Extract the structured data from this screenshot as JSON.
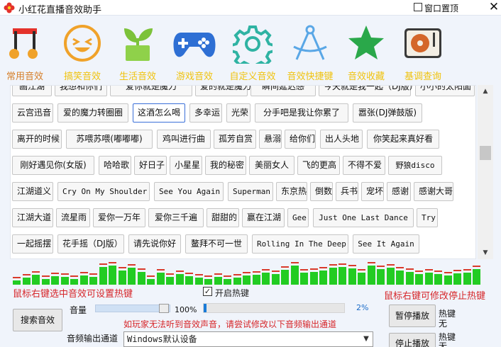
{
  "window": {
    "title": "小红花直播音效助手",
    "pin_label": "窗口置顶",
    "close_glyph": "✕"
  },
  "nav": [
    {
      "label": "常用音效",
      "icon": "music-note-icon",
      "active": true
    },
    {
      "label": "搞笑音效",
      "icon": "laughing-face-icon",
      "active": false
    },
    {
      "label": "生活音效",
      "icon": "plant-pot-icon",
      "active": false
    },
    {
      "label": "游戏音效",
      "icon": "gamepad-icon",
      "active": false
    },
    {
      "label": "自定义音效",
      "icon": "gear-icon",
      "active": false
    },
    {
      "label": "音效快捷键",
      "icon": "compass-icon",
      "active": false
    },
    {
      "label": "音效收藏",
      "icon": "star-icon",
      "active": false
    },
    {
      "label": "基调查询",
      "icon": "turntable-icon",
      "active": false
    }
  ],
  "songs": {
    "row0": [
      "画江湖",
      "我想和你们",
      "爱你就是魔力",
      "爱的就是魔力秀",
      "瞬间延迟感",
      "今天就是我一起（DJ版）",
      "小小的太阳面"
    ],
    "row1": [
      "云宫迅音",
      "爱的魔力转圈圈",
      "这酒怎么喝",
      "多幸运",
      "光荣",
      "分手吧是我让你累了",
      "嚣张(DJ弹鼓版)"
    ],
    "row2": [
      "离开的时候",
      "苏喂苏喂(嘟嘟嘟)",
      "鸡叫进行曲",
      "孤芳自赏",
      "悬溺",
      "给你们",
      "出人头地",
      "你笑起来真好看"
    ],
    "row3": [
      "刚好遇见你(女版)",
      "哈哈歌",
      "好日子",
      "小星星",
      "我的秘密",
      "美丽女人",
      "飞的更高",
      "不得不爱",
      "野狼disco"
    ],
    "row4": [
      "江湖道义",
      "Cry On My Shoulder",
      "See You Again",
      "Superman",
      "东京热",
      "倒数",
      "兵书",
      "宠坏",
      "感谢",
      "感谢大哥"
    ],
    "row5": [
      "江湖大道",
      "流星雨",
      "爱你一万年",
      "爱你三千遍",
      "甜甜的",
      "赢在江湖",
      "Gee",
      "Just One Last Dance",
      "Try"
    ],
    "row6": [
      "一起摇摆",
      "花手摇（DJ版）",
      "请先说你好",
      "鳌拜不可一世",
      "Rolling In The Deep",
      "See It Again"
    ]
  },
  "selected_song": "这酒怎么喝",
  "spectrum_levels": [
    0.22,
    0.35,
    0.5,
    0.28,
    0.42,
    0.38,
    0.3,
    0.45,
    0.4,
    0.9,
    0.95,
    0.72,
    0.85,
    0.65,
    0.3,
    0.6,
    0.4,
    0.55,
    0.42,
    0.35,
    0.28,
    0.4,
    0.3,
    0.35,
    0.45,
    0.5,
    0.6,
    0.55,
    0.75,
    0.95,
    0.6,
    0.65,
    0.7,
    0.85,
    0.9,
    0.82,
    0.6,
    0.95,
    0.78,
    0.85,
    0.72,
    0.65,
    0.55,
    0.6,
    0.55,
    0.48,
    0.58,
    0.62,
    0.8
  ],
  "hints": {
    "left": "鼠标右键选中音效可设置热键",
    "right": "鼠标右键可修改停止热键",
    "output_warning": "如玩家无法听到音效声音，请尝试修改以下音频输出通道"
  },
  "hotkey": {
    "label": "开启热键",
    "checked": true
  },
  "volume": {
    "label": "音量",
    "value_text": "100%",
    "level": 1.0
  },
  "progress": {
    "value_text": "2%",
    "level": 0.02
  },
  "buttons": {
    "search": "搜索音效",
    "pause": "暂停播放",
    "stop": "停止播放"
  },
  "hotkey_status": {
    "pause_label": "热键",
    "pause_value": "无",
    "stop_label": "热键",
    "stop_value": "无"
  },
  "output": {
    "label": "音频输出通道",
    "selected": "Windows默认设备"
  },
  "colors": {
    "accent_label": "#f0c30f",
    "active_label": "#d67f2a",
    "warning": "#d6262a",
    "spectrum": "#22cc22",
    "spectrum_peak": "#d93a2b"
  }
}
